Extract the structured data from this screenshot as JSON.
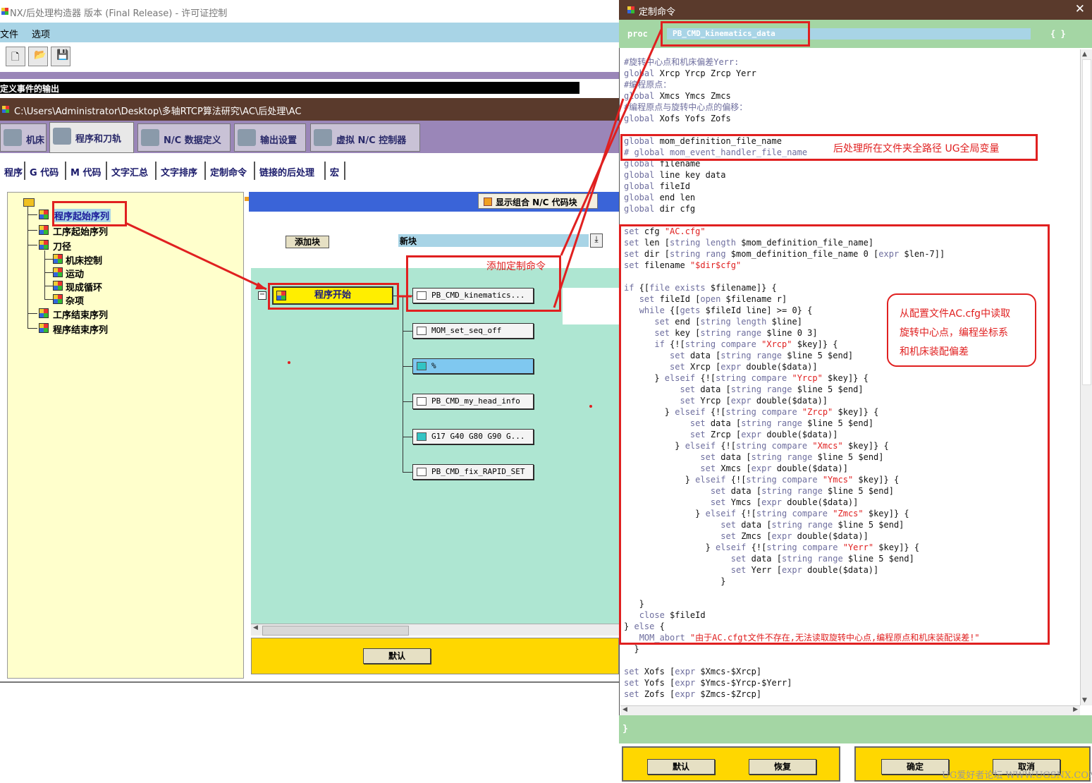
{
  "main_window": {
    "title": "NX/后处理构造器 版本 (Final Release) - 许可证控制",
    "menu": [
      "文件",
      "选项"
    ],
    "toolbar_icons": [
      "new-file-icon",
      "open-folder-icon",
      "save-icon"
    ],
    "output_bar": "定义事件的输出",
    "path": "C:\\Users\\Administrator\\Desktop\\多轴RTCP算法研究\\AC\\后处理\\AC",
    "main_tabs": [
      "机床",
      "程序和刀轨",
      "N/C 数据定义",
      "输出设置",
      "虚拟 N/C 控制器"
    ],
    "sub_tabs": [
      "程序",
      "G 代码",
      "M 代码",
      "文字汇总",
      "文字排序",
      "定制命令",
      "链接的后处理",
      "宏"
    ],
    "tree": {
      "items": [
        "程序起始序列",
        "工序起始序列",
        "刀径",
        "机床控制",
        "运动",
        "现成循环",
        "杂项",
        "工序结束序列",
        "程序结束序列"
      ]
    },
    "show_combo_label": "显示组合 N/C 代码块",
    "add_block_label": "添加块",
    "new_block_value": "新块",
    "start_block_label": "程序开始",
    "event_blocks": [
      "PB_CMD_kinematics...",
      "MOM_set_seq_off",
      "%",
      "PB_CMD_my_head_info",
      "G17 G40 G80 G90 G...",
      "PB_CMD_fix_RAPID_SET"
    ],
    "default_button": "默认"
  },
  "annotations": {
    "add_custom_command": "添加定制命令",
    "global_var_note": "后处理所在文件夹全路径 UG全局变量",
    "read_config_note": [
      "从配置文件AC.cfg中读取",
      "旋转中心点，编程坐标系",
      "和机床装配偏差"
    ]
  },
  "dialog": {
    "title": "定制命令",
    "close_glyph": "✕",
    "proc_keyword": "proc",
    "proc_name": "PB_CMD_kinematics_data",
    "proc_brace": "{ }",
    "close_brace": "}",
    "buttons": {
      "default": "默认",
      "restore": "恢复",
      "ok": "确定",
      "cancel": "取消"
    },
    "code": [
      "#旋转中心点和机床偏差Yerr:",
      "global Xrcp Yrcp Zrcp Yerr",
      "#编程原点：",
      "global Xmcs Ymcs Zmcs",
      "#编程原点与旋转中心点的偏移：",
      "global Xofs Yofs Zofs",
      "",
      "global mom_definition_file_name",
      "# global mom_event_handler_file_name",
      "global filename",
      "global line key data",
      "global fileId",
      "global end len",
      "global dir cfg",
      "",
      "set cfg \"AC.cfg\"",
      "set len [string length $mom_definition_file_name]",
      "set dir [string rang $mom_definition_file_name 0 [expr $len-7]]",
      "set filename \"$dir$cfg\"",
      "",
      "if {[file exists $filename]} {",
      "   set fileId [open $filename r]",
      "   while {[gets $fileId line] >= 0} {",
      "      set end [string length $line]",
      "      set key [string range $line 0 3]",
      "      if {![string compare \"Xrcp\" $key]} {",
      "         set data [string range $line 5 $end]",
      "         set Xrcp [expr double($data)]",
      "      } elseif {![string compare \"Yrcp\" $key]} {",
      "           set data [string range $line 5 $end]",
      "           set Yrcp [expr double($data)]",
      "        } elseif {![string compare \"Zrcp\" $key]} {",
      "             set data [string range $line 5 $end]",
      "             set Zrcp [expr double($data)]",
      "          } elseif {![string compare \"Xmcs\" $key]} {",
      "               set data [string range $line 5 $end]",
      "               set Xmcs [expr double($data)]",
      "            } elseif {![string compare \"Ymcs\" $key]} {",
      "                 set data [string range $line 5 $end]",
      "                 set Ymcs [expr double($data)]",
      "              } elseif {![string compare \"Zmcs\" $key]} {",
      "                   set data [string range $line 5 $end]",
      "                   set Zmcs [expr double($data)]",
      "                } elseif {![string compare \"Yerr\" $key]} {",
      "                     set data [string range $line 5 $end]",
      "                     set Yerr [expr double($data)]",
      "                   }",
      "",
      "   }",
      "   close $fileId",
      "} else {",
      "   MOM_abort \"由于AC.cfgt文件不存在,无法读取旋转中心点,编程原点和机床装配误差!\"",
      "  }",
      "",
      "set Xofs [expr $Xmcs-$Xrcp]",
      "set Yofs [expr $Ymcs-$Yrcp-$Yerr]",
      "set Zofs [expr $Zmcs-$Zrcp]"
    ]
  },
  "watermark": "UG爱好者论坛 WWW.UGSNX.COM",
  "colors": {
    "annotation_red": "#e02020",
    "dialog_green": "#a4d6a4",
    "yellow": "#ffd700"
  }
}
